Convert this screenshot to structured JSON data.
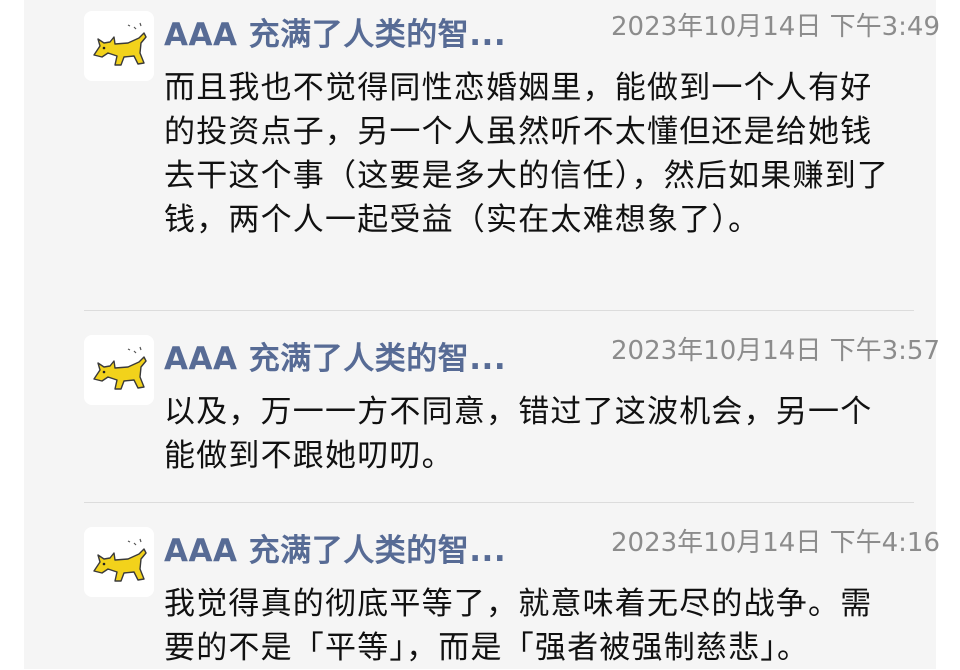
{
  "messages": [
    {
      "sender": "AAA 充满了人类的智...",
      "time": "2023年10月14日 下午3:49",
      "text": "而且我也不觉得同性恋婚姻里，能做到一个人有好的投资点子，另一个人虽然听不太懂但还是给她钱去干这个事（这要是多大的信任），然后如果赚到了钱，两个人一起受益（实在太难想象了）。"
    },
    {
      "sender": "AAA 充满了人类的智...",
      "time": "2023年10月14日 下午3:57",
      "text": "以及，万一一方不同意，错过了这波机会，另一个能做到不跟她叨叨。"
    },
    {
      "sender": "AAA 充满了人类的智...",
      "time": "2023年10月14日 下午4:16",
      "text": "我觉得真的彻底平等了，就意味着无尽的战争。需要的不是「平等」，而是「强者被强制慈悲」。"
    }
  ],
  "avatar_icon": "cat-icon",
  "colors": {
    "sender": "#576b95",
    "time": "#8c8c8c",
    "text": "#111111",
    "panel": "#f5f5f5",
    "avatar_cat": "#f2d21b"
  }
}
